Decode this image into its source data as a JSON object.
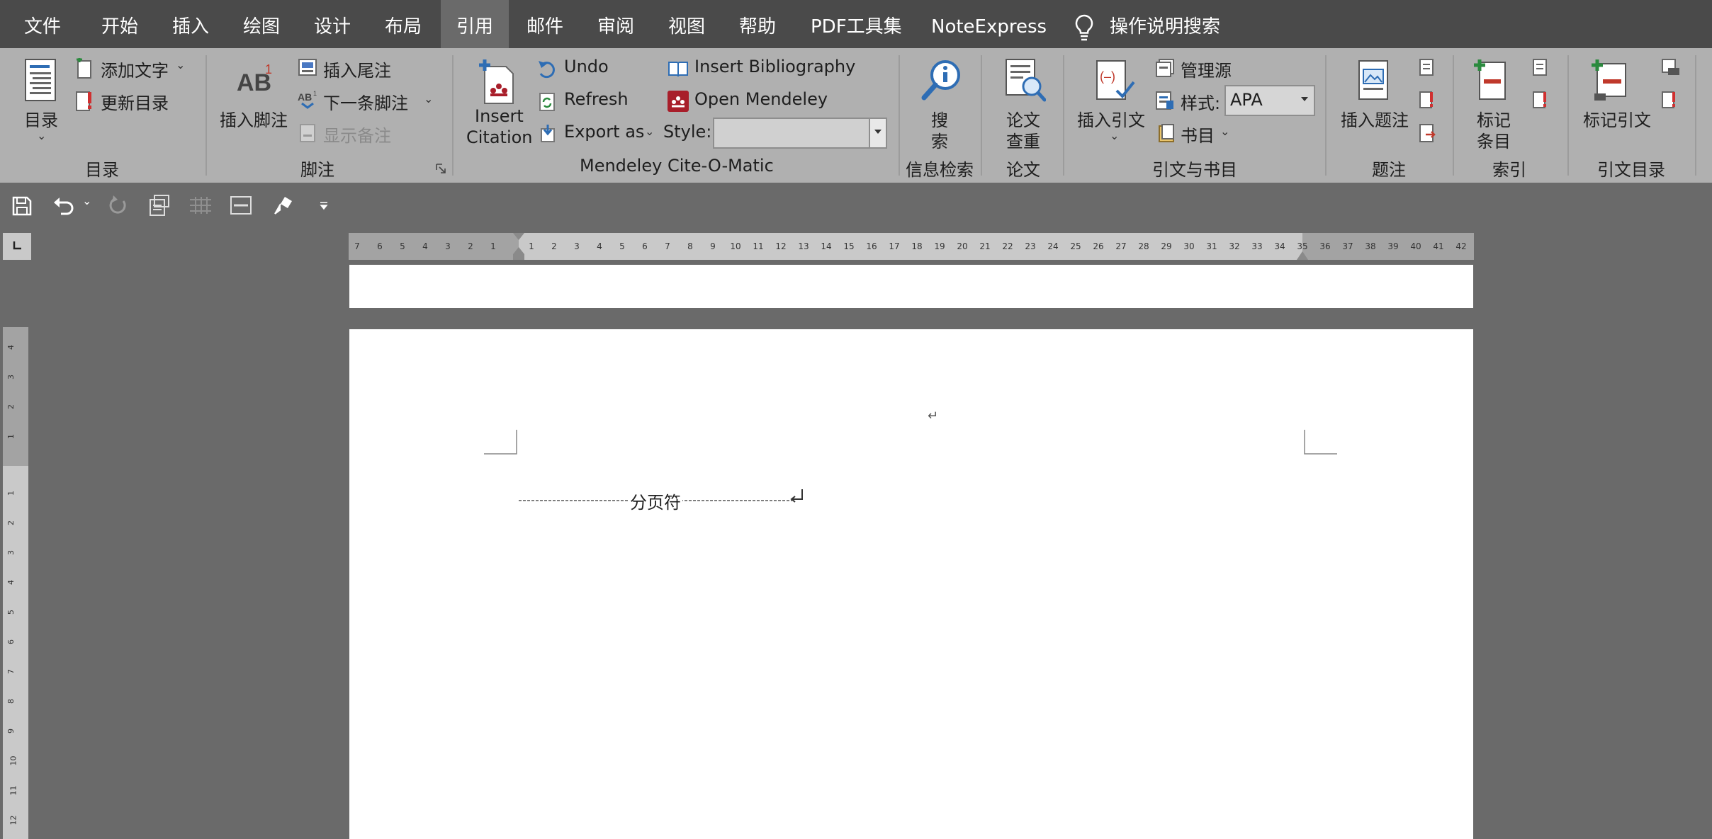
{
  "tabs": [
    "文件",
    "开始",
    "插入",
    "绘图",
    "设计",
    "布局",
    "引用",
    "邮件",
    "审阅",
    "视图",
    "帮助",
    "PDF工具集",
    "NoteExpress"
  ],
  "active_tab": "引用",
  "tell_me": "操作说明搜索",
  "ribbon": {
    "toc": {
      "toc_button": "目录",
      "add_text": "添加文字",
      "update_table": "更新目录",
      "group_label": "目录"
    },
    "footnotes": {
      "insert_footnote": "插入脚注",
      "insert_endnote": "插入尾注",
      "next_footnote": "下一条脚注",
      "show_notes": "显示备注",
      "group_label": "脚注"
    },
    "mendeley": {
      "insert_citation_line1": "Insert",
      "insert_citation_line2": "Citation",
      "undo": "Undo",
      "refresh": "Refresh",
      "export_as": "Export as",
      "insert_bibliography": "Insert Bibliography",
      "open_mendeley": "Open Mendeley",
      "style_label": "Style:",
      "style_value": "",
      "group_label": "Mendeley Cite-O-Matic"
    },
    "research": {
      "search_line1": "搜",
      "search_line2": "索",
      "group_label": "信息检索"
    },
    "paper": {
      "check_line1": "论文",
      "check_line2": "查重",
      "group_label": "论文"
    },
    "citations": {
      "insert_citation": "插入引文",
      "manage_sources": "管理源",
      "style_label": "样式:",
      "style_value": "APA",
      "bibliography": "书目",
      "group_label": "引文与书目"
    },
    "captions": {
      "insert_caption": "插入题注",
      "group_label": "题注"
    },
    "index": {
      "mark_entry_line1": "标记",
      "mark_entry_line2": "条目",
      "group_label": "索引"
    },
    "toa": {
      "mark_citation": "标记引文",
      "group_label": "引文目录"
    }
  },
  "ruler": {
    "left_numbers": [
      "7",
      "6",
      "5",
      "4",
      "3",
      "2",
      "1"
    ],
    "right_numbers": [
      "1",
      "2",
      "3",
      "4",
      "5",
      "6",
      "7",
      "8",
      "9",
      "10",
      "11",
      "12",
      "13",
      "14",
      "15",
      "16",
      "17",
      "18",
      "19",
      "20",
      "21",
      "22",
      "23",
      "24",
      "25",
      "26",
      "27",
      "28",
      "29",
      "30",
      "31",
      "32",
      "33",
      "34",
      "35",
      "36",
      "37",
      "38",
      "39",
      "40",
      "41",
      "42"
    ],
    "vertical_top": [
      "4",
      "3",
      "2",
      "1"
    ],
    "vertical_body": [
      "1",
      "2",
      "3",
      "4",
      "5",
      "6",
      "7",
      "8",
      "9",
      "10",
      "11",
      "12"
    ]
  },
  "document": {
    "page_break_label": "分页符",
    "paragraph_mark": "↵"
  },
  "colors": {
    "tab_bar": "#4a4a4a",
    "ribbon": "#b0b0b0",
    "workspace": "#6a6a6a",
    "page": "#ffffff",
    "mendeley_red": "#a81e2a"
  }
}
